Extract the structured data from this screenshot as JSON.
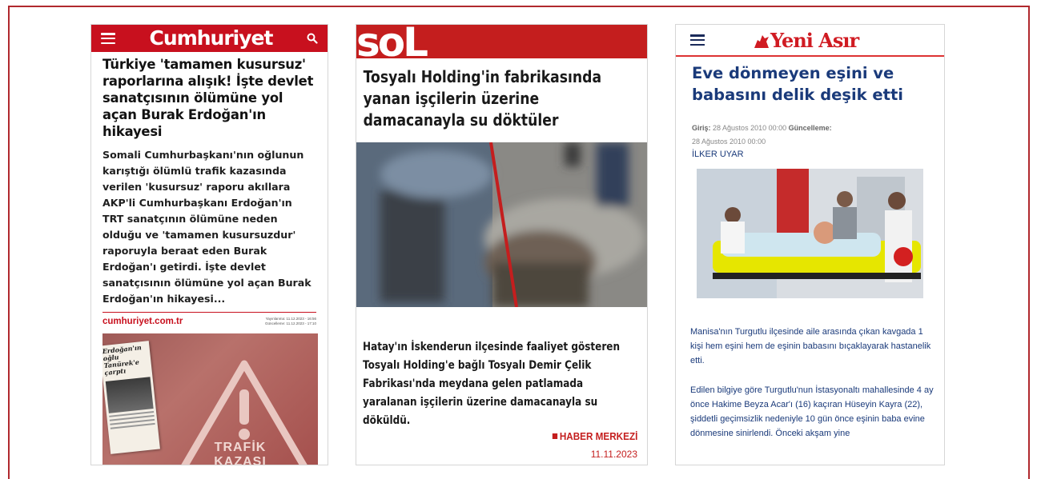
{
  "panel1": {
    "logo": "Cumhuriyet",
    "title": "Türkiye 'tamamen kusursuz' raporlarına alışık! İşte devlet sanatçısının ölümüne yol açan Burak Erdoğan'ın hikayesi",
    "summary": "Somali Cumhurbaşkanı'nın oğlunun karıştığı ölümlü trafik kazasında verilen 'kusursuz' raporu akıllara AKP'li Cumhurbaşkanı Erdoğan'ın TRT sanatçının ölümüne neden olduğu ve 'tamamen kusursuzdur' raporuyla beraat eden Burak Erdoğan'ı getirdi. İşte devlet sanatçısının ölümüne yol açan Burak Erdoğan'ın hikayesi...",
    "source": "cumhuriyet.com.tr",
    "published": "Yayınlanma: 11.12.2023 - 16:56",
    "updated": "Güncelleme: 11.12.2023 - 17:10",
    "clip_headline": "Erdoğan'ın oğlu Tanürek'e çarptı",
    "sign_line1": "TRAFİK",
    "sign_line2": "KAZASI",
    "colors": {
      "brand": "#c8101e"
    }
  },
  "panel2": {
    "logo": "soL",
    "title": "Tosyalı Holding'in fabrikasında yanan işçilerin üzerine damacanayla su döktüler",
    "summary": "Hatay'ın İskenderun ilçesinde faaliyet gösteren Tosyalı Holding'e bağlı Tosyalı Demir Çelik Fabrikası'nda meydana gelen patlamada yaralanan işçilerin üzerine damacanayla su döküldü.",
    "byline": "HABER MERKEZİ",
    "date": "11.11.2023",
    "colors": {
      "brand": "#c41e1e"
    }
  },
  "panel3": {
    "logo": "Yeni Asır",
    "title": "Eve dönmeyen eşini ve babasını delik deşik etti",
    "meta_label_in": "Giriş:",
    "meta_in": "28 Ağustos 2010 00:00",
    "meta_label_up": "Güncelleme:",
    "meta_up": "28 Ağustos 2010 00:00",
    "author": "İLKER UYAR",
    "para1": "Manisa'nın Turgutlu ilçesinde aile arasında çıkan kavgada 1 kişi hem eşini hem de eşinin babasını bıçaklayarak hastanelik etti.",
    "para2": "Edilen bilgiye göre Turgutlu'nun İstasyonaltı mahallesinde 4 ay önce Hakime Beyza Acar'ı (16) kaçıran Hüseyin Kayra (22), şiddetli geçimsizlik nedeniyle 10 gün önce eşinin baba evine dönmesine sinirlendi. Önceki akşam yine",
    "colors": {
      "brand": "#d01b22",
      "text": "#1a3a7a"
    }
  }
}
